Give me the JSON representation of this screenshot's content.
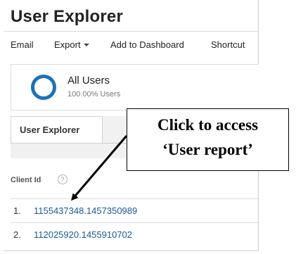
{
  "page": {
    "title": "User Explorer"
  },
  "toolbar": {
    "email": "Email",
    "export": "Export",
    "add_to_dashboard": "Add to Dashboard",
    "shortcut": "Shortcut"
  },
  "segment": {
    "name": "All Users",
    "percentage": "100.00% Users",
    "ring_color": "#1a73ba"
  },
  "tabs": [
    {
      "label": "User Explorer",
      "selected": true
    }
  ],
  "table": {
    "column_header": "Client Id",
    "help_icon_glyph": "?",
    "rows": [
      {
        "index": "1.",
        "client_id": "1155437348.1457350989"
      },
      {
        "index": "2.",
        "client_id": "112025920.1455910702"
      }
    ],
    "link_color": "#1a5a96"
  },
  "annotation": {
    "line1": "Click to access",
    "line2": "‘User report’"
  }
}
